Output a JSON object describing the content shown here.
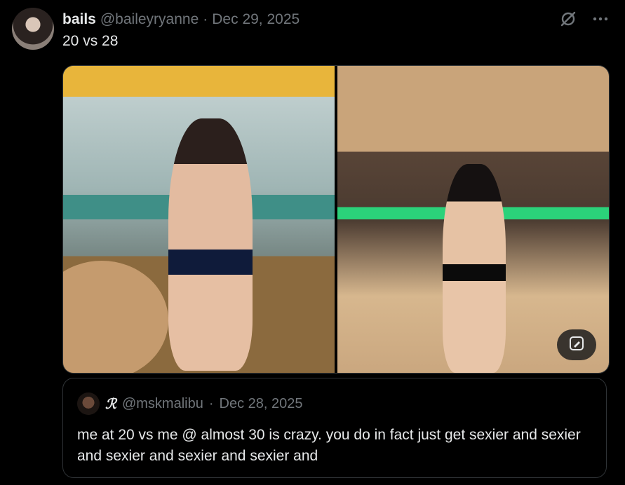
{
  "post": {
    "display_name": "bails",
    "handle": "@baileyryanne",
    "separator": "·",
    "date": "Dec 29, 2025",
    "text": "20 vs 28"
  },
  "icons": {
    "grok": "grok-icon",
    "more": "more-icon",
    "edit_image": "edit-image-icon"
  },
  "quote": {
    "display_name": "ℛ",
    "handle": "@mskmalibu",
    "separator": "·",
    "date": "Dec 28, 2025",
    "text": "me at 20 vs me @ almost 30 is crazy. you do in fact just get sexier and sexier and sexier and sexier and sexier and"
  },
  "colors": {
    "background": "#000000",
    "text_primary": "#e7e9ea",
    "text_secondary": "#71767b",
    "border": "#2f3336"
  }
}
